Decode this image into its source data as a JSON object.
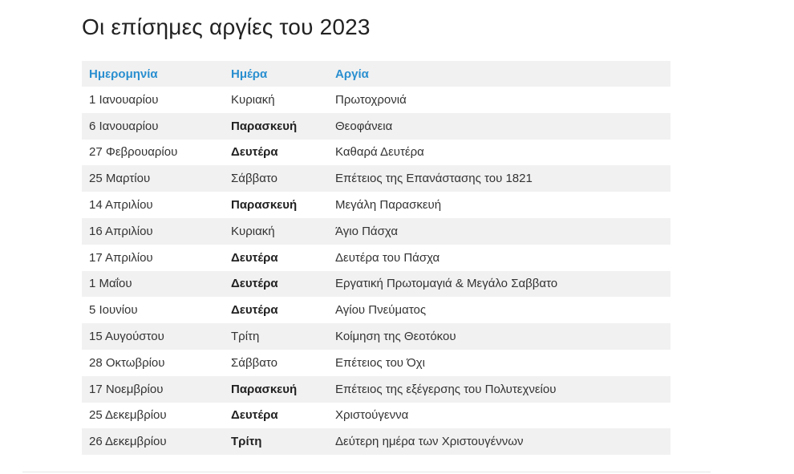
{
  "title": "Οι επίσημες αργίες του 2023",
  "table": {
    "headers": {
      "date": "Ημερομηνία",
      "day": "Ημέρα",
      "holiday": "Αργία"
    },
    "rows": [
      {
        "date": "1 Ιανουαρίου",
        "day": "Κυριακή",
        "day_bold": false,
        "holiday": "Πρωτοχρονιά"
      },
      {
        "date": "6 Ιανουαρίου",
        "day": "Παρασκευή",
        "day_bold": true,
        "holiday": "Θεοφάνεια"
      },
      {
        "date": "27 Φεβρουαρίου",
        "day": "Δευτέρα",
        "day_bold": true,
        "holiday": "Καθαρά Δευτέρα"
      },
      {
        "date": "25 Μαρτίου",
        "day": "Σάββατο",
        "day_bold": false,
        "holiday": "Επέτειος της Επανάστασης του 1821"
      },
      {
        "date": "14 Απριλίου",
        "day": "Παρασκευή",
        "day_bold": true,
        "holiday": "Μεγάλη Παρασκευή"
      },
      {
        "date": "16 Απριλίου",
        "day": "Κυριακή",
        "day_bold": false,
        "holiday": "Άγιο Πάσχα"
      },
      {
        "date": "17 Απριλίου",
        "day": "Δευτέρα",
        "day_bold": true,
        "holiday": "Δευτέρα του Πάσχα"
      },
      {
        "date": "1 Μαΐου",
        "day": "Δευτέρα",
        "day_bold": true,
        "holiday": "Εργατική Πρωτομαγιά & Μεγάλο Σαββατο"
      },
      {
        "date": "5 Ιουνίου",
        "day": "Δευτέρα",
        "day_bold": true,
        "holiday": "Αγίου Πνεύματος"
      },
      {
        "date": "15 Αυγούστου",
        "day": "Τρίτη",
        "day_bold": false,
        "holiday": "Κοίμηση της Θεοτόκου"
      },
      {
        "date": "28 Οκτωβρίου",
        "day": "Σάββατο",
        "day_bold": false,
        "holiday": "Επέτειος του Όχι"
      },
      {
        "date": "17 Νοεμβρίου",
        "day": "Παρασκευή",
        "day_bold": true,
        "holiday": "Επέτειος της εξέγερσης του Πολυτεχνείου"
      },
      {
        "date": "25 Δεκεμβρίου",
        "day": "Δευτέρα",
        "day_bold": true,
        "holiday": "Χριστούγεννα"
      },
      {
        "date": "26 Δεκεμβρίου",
        "day": "Τρίτη",
        "day_bold": true,
        "holiday": "Δεύτερη ημέρα των Χριστουγέννων"
      }
    ]
  },
  "colors": {
    "header_text": "#2a8fd0",
    "row_shade": "#f1f1f1",
    "body_text": "#333333"
  }
}
